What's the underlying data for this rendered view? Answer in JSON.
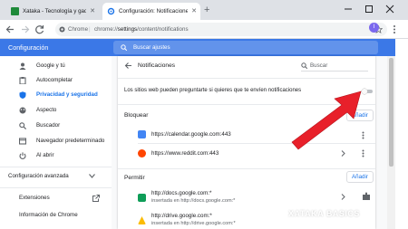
{
  "browser": {
    "tabs": [
      {
        "title": "Xataka - Tecnología y gadgets, m",
        "active": false
      },
      {
        "title": "Configuración: Notificaciones",
        "active": true
      }
    ],
    "omnibox": {
      "site": "Chrome",
      "separator": "|",
      "url_prefix": "chrome://",
      "url_strong": "settings",
      "url_rest": "/content/notifications"
    },
    "avatar_letter": "I"
  },
  "header": {
    "title": "Configuración",
    "search_placeholder": "Buscar ajustes"
  },
  "sidebar": {
    "items": [
      {
        "label": "Google y tú",
        "icon": "person-icon"
      },
      {
        "label": "Autocompletar",
        "icon": "clipboard-icon"
      },
      {
        "label": "Privacidad y seguridad",
        "icon": "shield-icon",
        "active": true
      },
      {
        "label": "Aspecto",
        "icon": "palette-icon"
      },
      {
        "label": "Buscador",
        "icon": "search-icon"
      },
      {
        "label": "Navegador predeterminado",
        "icon": "browser-icon"
      },
      {
        "label": "Al abrir",
        "icon": "power-icon"
      }
    ],
    "advanced": "Configuración avanzada",
    "extensions": "Extensiones",
    "about": "Información de Chrome"
  },
  "main": {
    "page_title": "Notificaciones",
    "search_placeholder": "Buscar",
    "ask_label": "Los sitios web pueden preguntarte si quieres que te envíen notificaciones",
    "block": {
      "title": "Bloquear",
      "add_label": "Añadir",
      "sites": [
        {
          "url": "https://calendar.google.com:443",
          "favicon_color": "#4285f4"
        },
        {
          "url": "https://www.reddit.com:443",
          "favicon_color": "#ff4500"
        }
      ]
    },
    "allow": {
      "title": "Permitir",
      "add_label": "Añadir",
      "sites": [
        {
          "url": "http://docs.google.com:*",
          "note": "insertada en http://docs.google.com:*",
          "favicon_color": "#0f9d58"
        },
        {
          "url": "http://drive.google.com:*",
          "note": "insertada en http://drive.google.com:*",
          "favicon_color": "#fbbc04"
        }
      ]
    }
  },
  "watermark": "XATAKA BASICS",
  "colors": {
    "accent": "#1a73e8",
    "header": "#3b78e7",
    "annotation_arrow": "#e8202a"
  }
}
